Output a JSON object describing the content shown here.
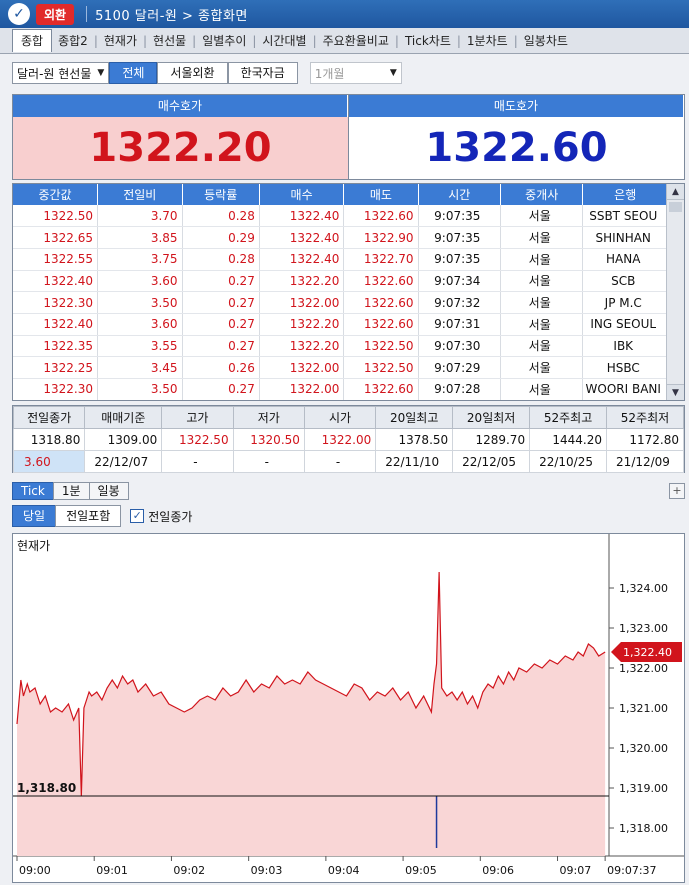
{
  "app": {
    "badge": "외환",
    "title": "5100 달러-원 > 종합화면"
  },
  "tabs": [
    "종합",
    "종합2",
    "현재가",
    "현선물",
    "일별추이",
    "시간대별",
    "주요환율비교",
    "Tick차트",
    "1분차트",
    "일봉차트"
  ],
  "filters": {
    "instrument": "달러-원 현선물",
    "segments": [
      "전체",
      "서울외환",
      "한국자금"
    ],
    "period": "1개월"
  },
  "quote": {
    "bid_label": "매수호가",
    "bid": "1322.20",
    "ask_label": "매도호가",
    "ask": "1322.60"
  },
  "ticks": {
    "headers": [
      "중간값",
      "전일비",
      "등락률",
      "매수",
      "매도",
      "시간",
      "중개사",
      "은행"
    ],
    "rows": [
      [
        "1322.50",
        "3.70",
        "0.28",
        "1322.40",
        "1322.60",
        "9:07:35",
        "서울",
        "SSBT SEOU"
      ],
      [
        "1322.65",
        "3.85",
        "0.29",
        "1322.40",
        "1322.90",
        "9:07:35",
        "서울",
        "SHINHAN"
      ],
      [
        "1322.55",
        "3.75",
        "0.28",
        "1322.40",
        "1322.70",
        "9:07:35",
        "서울",
        "HANA"
      ],
      [
        "1322.40",
        "3.60",
        "0.27",
        "1322.20",
        "1322.60",
        "9:07:34",
        "서울",
        "SCB"
      ],
      [
        "1322.30",
        "3.50",
        "0.27",
        "1322.00",
        "1322.60",
        "9:07:32",
        "서울",
        "JP M.C"
      ],
      [
        "1322.40",
        "3.60",
        "0.27",
        "1322.20",
        "1322.60",
        "9:07:31",
        "서울",
        "ING SEOUL"
      ],
      [
        "1322.35",
        "3.55",
        "0.27",
        "1322.20",
        "1322.50",
        "9:07:30",
        "서울",
        "IBK"
      ],
      [
        "1322.25",
        "3.45",
        "0.26",
        "1322.00",
        "1322.50",
        "9:07:29",
        "서울",
        "HSBC"
      ],
      [
        "1322.30",
        "3.50",
        "0.27",
        "1322.00",
        "1322.60",
        "9:07:28",
        "서울",
        "WOORI BANI"
      ]
    ]
  },
  "stats": {
    "headers": [
      "전일종가",
      "매매기준",
      "고가",
      "저가",
      "시가",
      "20일최고",
      "20일최저",
      "52주최고",
      "52주최저"
    ],
    "row1": [
      "1318.80",
      "1309.00",
      "1322.50",
      "1320.50",
      "1322.00",
      "1378.50",
      "1289.70",
      "1444.20",
      "1172.80"
    ],
    "row2": [
      "3.60",
      "22/12/07",
      "-",
      "-",
      "-",
      "22/11/10",
      "22/12/05",
      "22/10/25",
      "21/12/09"
    ]
  },
  "subtabs": [
    "Tick",
    "1분",
    "일봉"
  ],
  "controls": {
    "today": "당일",
    "include_prev": "전일포함",
    "prev_close_check": "전일종가"
  },
  "chart_data": {
    "type": "area",
    "title": "현재가",
    "prev_close_label": "1,318.80",
    "prev_close": 1318.8,
    "last_label": "1,322.40",
    "last": 1322.4,
    "ylim": [
      1317.3,
      1324.9
    ],
    "yticks": [
      "1,324.00",
      "1,323.00",
      "1,322.00",
      "1,321.00",
      "1,320.00",
      "1,319.00",
      "1,318.00"
    ],
    "ytick_values": [
      1324,
      1323,
      1322,
      1321,
      1320,
      1319,
      1318
    ],
    "xticks": [
      "09:00",
      "09:01",
      "09:02",
      "09:03",
      "09:04",
      "09:05",
      "09:06",
      "09:07",
      "09:07:37"
    ],
    "xtick_values": [
      0,
      60,
      120,
      180,
      240,
      300,
      360,
      420,
      457
    ],
    "xlim": [
      0,
      460
    ],
    "series": [
      {
        "x": [
          0,
          3,
          5,
          8,
          10,
          14,
          18,
          22,
          26,
          30,
          35,
          40,
          44,
          48,
          50,
          52,
          54,
          56,
          58,
          62,
          66,
          70,
          74,
          78,
          82,
          86,
          90,
          94,
          100,
          106,
          112,
          118,
          124,
          130,
          136,
          142,
          148,
          154,
          160,
          166,
          172,
          178,
          184,
          190,
          196,
          202,
          208,
          214,
          220,
          226,
          232,
          238,
          244,
          250,
          256,
          262,
          268,
          274,
          280,
          286,
          292,
          298,
          304,
          310,
          316,
          322,
          324,
          326,
          328,
          330,
          334,
          338,
          342,
          346,
          350,
          354,
          358,
          362,
          366,
          370,
          374,
          378,
          382,
          386,
          390,
          396,
          402,
          408,
          414,
          420,
          426,
          432,
          436,
          440,
          444,
          448,
          452,
          457
        ],
        "y": [
          1320.6,
          1321.7,
          1321.3,
          1321.6,
          1321.4,
          1321.5,
          1321.1,
          1321.3,
          1320.9,
          1321.0,
          1320.9,
          1321.1,
          1320.7,
          1321.0,
          1318.8,
          1321.0,
          1321.2,
          1321.4,
          1321.3,
          1321.4,
          1321.2,
          1321.5,
          1321.7,
          1321.5,
          1321.8,
          1321.6,
          1321.7,
          1321.4,
          1321.6,
          1321.3,
          1321.4,
          1321.1,
          1321.0,
          1320.9,
          1321.0,
          1321.2,
          1321.3,
          1321.2,
          1321.5,
          1321.3,
          1321.4,
          1321.7,
          1321.4,
          1321.6,
          1321.5,
          1321.8,
          1321.6,
          1321.7,
          1321.6,
          1321.9,
          1321.7,
          1321.6,
          1321.5,
          1321.4,
          1321.3,
          1321.6,
          1321.5,
          1321.2,
          1321.4,
          1321.3,
          1321.5,
          1321.2,
          1321.4,
          1321.0,
          1321.3,
          1320.9,
          1321.6,
          1322.1,
          1324.4,
          1321.5,
          1321.3,
          1321.4,
          1321.2,
          1321.4,
          1321.1,
          1321.3,
          1321.0,
          1321.4,
          1321.6,
          1321.5,
          1321.8,
          1321.6,
          1321.9,
          1321.7,
          1322.0,
          1321.9,
          1322.1,
          1322.0,
          1322.2,
          1322.1,
          1322.3,
          1322.2,
          1322.4,
          1322.3,
          1322.6,
          1322.5,
          1322.3,
          1322.4
        ]
      }
    ]
  }
}
